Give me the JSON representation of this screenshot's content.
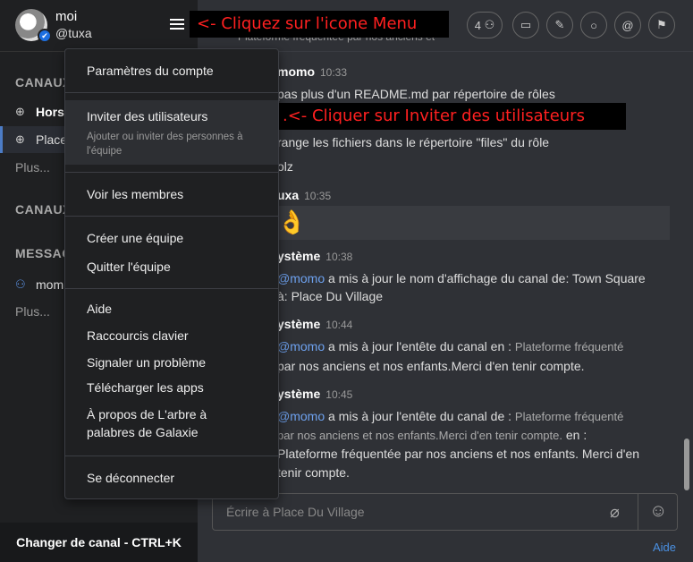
{
  "user": {
    "name": "moi",
    "handle": "@tuxa",
    "badge": "✔"
  },
  "sidebar": {
    "section_channels": "CANAUX",
    "channels": [
      {
        "label": "Hors"
      },
      {
        "label": "Place"
      }
    ],
    "more1": "Plus...",
    "section_channels2": "CANAUX",
    "section_messages": "MESSAG",
    "dm": {
      "label": "mom"
    },
    "more2": "Plus...",
    "footer": "Changer de canal - CTRL+K"
  },
  "header": {
    "subtitle": "Plateforme fréquentée par nos anciens et",
    "member_count": "4"
  },
  "messages": {
    "m1_author": "momo",
    "m1_time": "10:33",
    "m1_line1": "pas plus d'un README.md par répertoire de rôles",
    "m1_line2": "range les fichiers dans le répertoire \"files\" du rôle",
    "m1_line3": "olz",
    "m2_author": "uxa",
    "m2_time": "10:35",
    "m2_emoji": "👌",
    "s1_author": "ystème",
    "s1_time": "10:38",
    "s1_mention": "@momo",
    "s1_text": " a mis à jour le nom d'affichage du canal de: Town Square",
    "s1_text2": "à: Place Du Village",
    "s2_author": "ystème",
    "s2_time": "10:44",
    "s2_mention": "@momo",
    "s2_text": " a mis à jour l'entête du canal en : ",
    "s2_small1": "Plateforme fréquenté",
    "s2_small2": "par nos anciens et nos enfants.Merci d'en tenir compte.",
    "s3_author": "ystème",
    "s3_time": "10:45",
    "s3_mention": "@momo",
    "s3_text": " a mis à jour l'entête du canal de : ",
    "s3_small1": "Plateforme fréquenté",
    "s3_small2": "par nos anciens et nos enfants.Merci d'en tenir compte.",
    "s3_en": " en :",
    "s3_small3": "Plateforme fréquentée par nos anciens et nos enfants. Merci d'en",
    "s3_small4": "tenir compte."
  },
  "input": {
    "placeholder": "Écrire à Place Du Village"
  },
  "help_link": "Aide",
  "annotations": {
    "menu": "<- Cliquez sur l'icone Menu",
    "invite": ".<- Cliquer sur Inviter des utilisateurs"
  },
  "menu": {
    "account_settings": "Paramètres du compte",
    "invite_users": "Inviter des utilisateurs",
    "invite_hint": "Ajouter ou inviter des personnes à l'équipe",
    "view_members": "Voir les membres",
    "create_team": "Créer une équipe",
    "leave_team": "Quitter l'équipe",
    "help": "Aide",
    "shortcuts": "Raccourcis clavier",
    "report_problem": "Signaler un problème",
    "download_apps": "Télécharger les apps",
    "about_line1": "À propos de L'arbre à",
    "about_line2": "palabres de Galaxie",
    "logout": "Se déconnecter"
  },
  "colors": {
    "accent": "#4c7cc6",
    "mention": "#6ea2f0",
    "annotation": "#ff2020",
    "link": "#4a90e2"
  }
}
